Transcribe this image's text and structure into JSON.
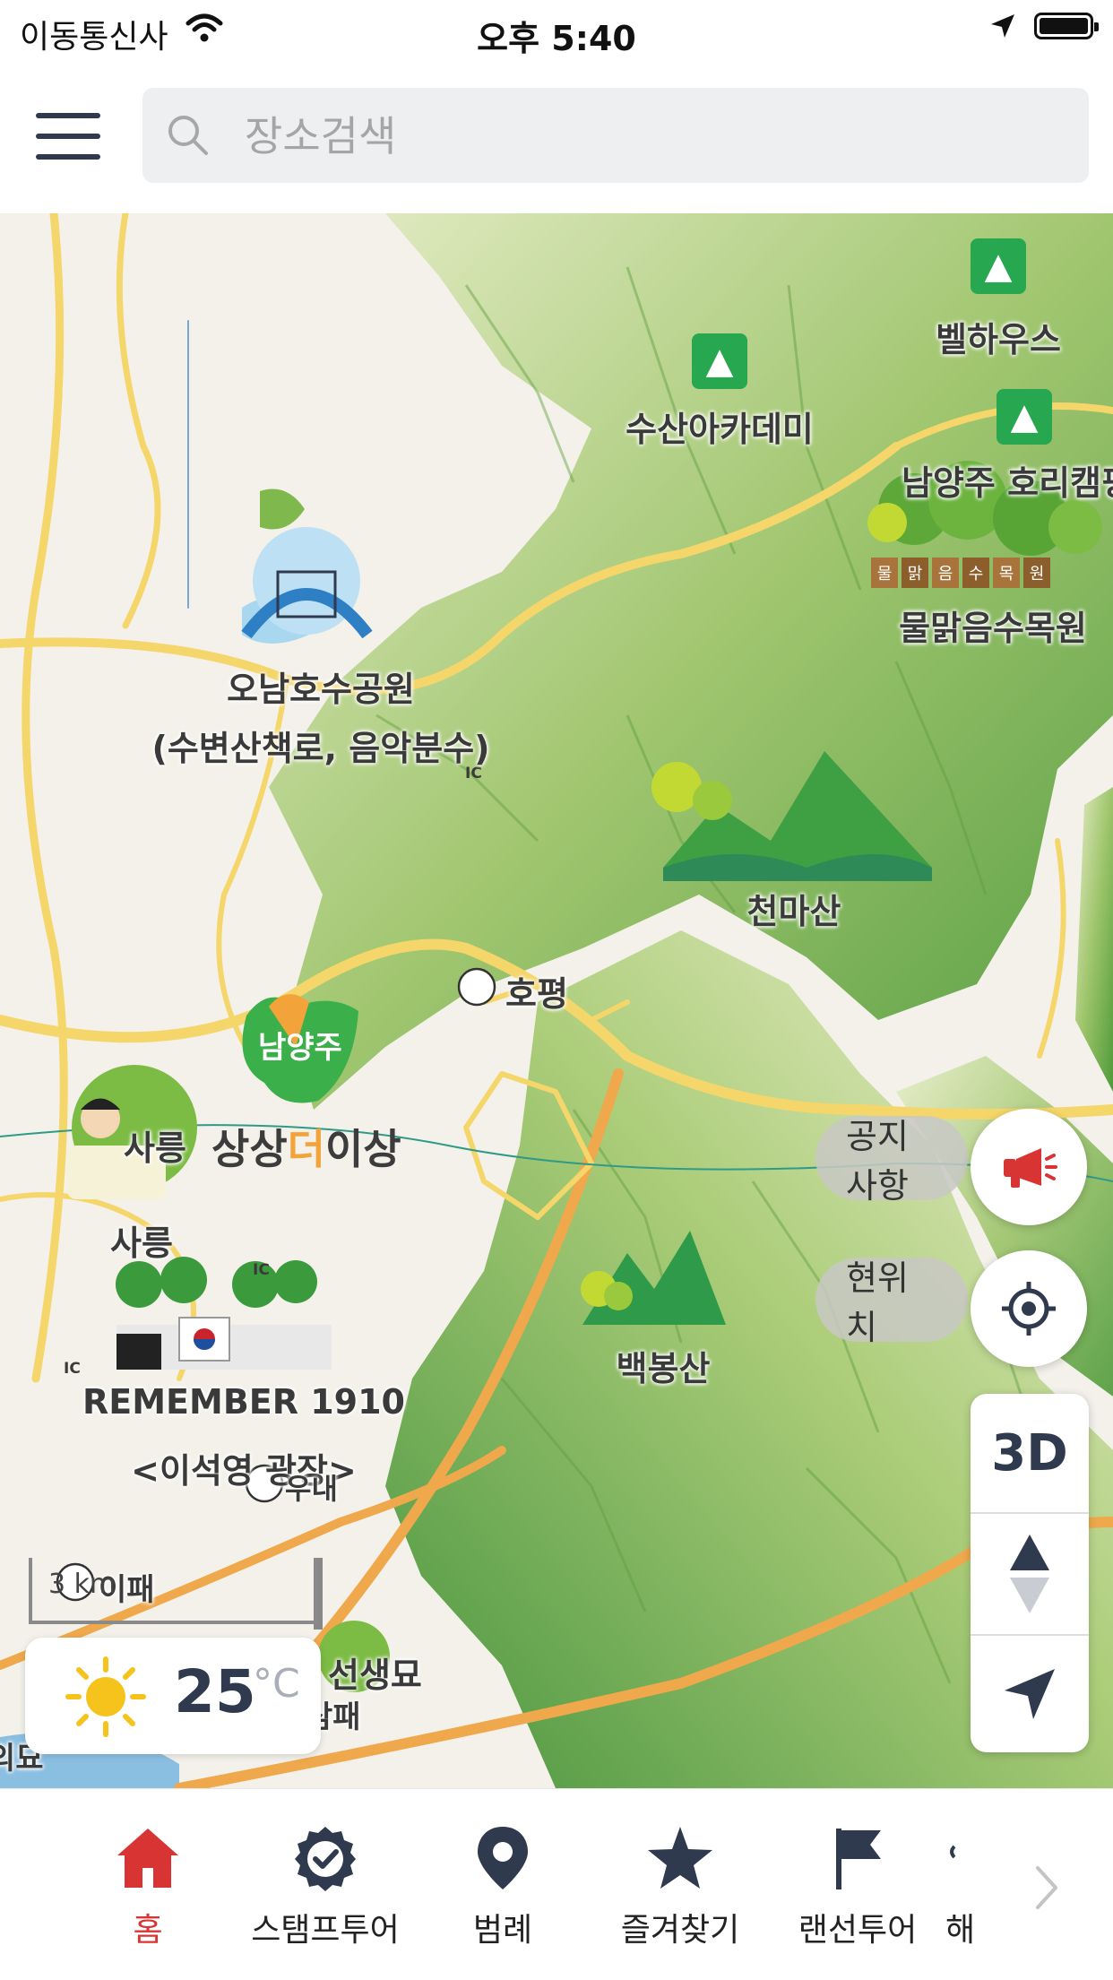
{
  "status_bar": {
    "carrier": "이동통신사",
    "time": "오후 5:40"
  },
  "search": {
    "placeholder": "장소검색"
  },
  "map": {
    "labels": {
      "bellhouse": "벨하우스",
      "susan_academy": "수산아카데미",
      "namyangju_camping": "남양주 호리캠핑",
      "arboretum_sign": [
        "물",
        "맑",
        "음",
        "수",
        "목",
        "원"
      ],
      "arboretum": "물맑음수목원",
      "lake_park": "오남호수공원",
      "lake_park_sub": "(수변산책로, 음악분수)",
      "cheonmasan": "천마산",
      "hopyeong_ic": "호평",
      "namyangju_logo": "남양주",
      "slogan_a": "상상",
      "slogan_b": "더",
      "slogan_c": "이상",
      "sareung_small": "사릉",
      "sareung": "사릉",
      "baekbongsan": "백봉산",
      "remember": "REMEMBER 1910",
      "remember_sub": "<이석영 광장>",
      "sunae_ic": "우내",
      "ipae": "이패",
      "tomb": "선생묘",
      "sampae": "삼패",
      "edge_label": "의묘"
    },
    "scale_text": "3 km",
    "ic_badge": "IC"
  },
  "buttons": {
    "notice": "공지사항",
    "current_location": "현위치",
    "mode_3d": "3D"
  },
  "weather": {
    "temperature": "25",
    "unit": "°C",
    "icon": "sun-icon"
  },
  "tabs": [
    {
      "label": "홈",
      "icon": "home-icon",
      "active": true
    },
    {
      "label": "스탬프투어",
      "icon": "stamp-badge-icon",
      "active": false
    },
    {
      "label": "범례",
      "icon": "map-pin-icon",
      "active": false
    },
    {
      "label": "즐겨찾기",
      "icon": "star-icon",
      "active": false
    },
    {
      "label": "랜선투어",
      "icon": "flag-icon",
      "active": false
    },
    {
      "label": "해",
      "icon": "partial-icon",
      "active": false
    }
  ],
  "colors": {
    "accent_red": "#d93434",
    "navy": "#2f3a4e",
    "map_green": "#6fae3c",
    "road_yellow": "#f5d66a"
  }
}
